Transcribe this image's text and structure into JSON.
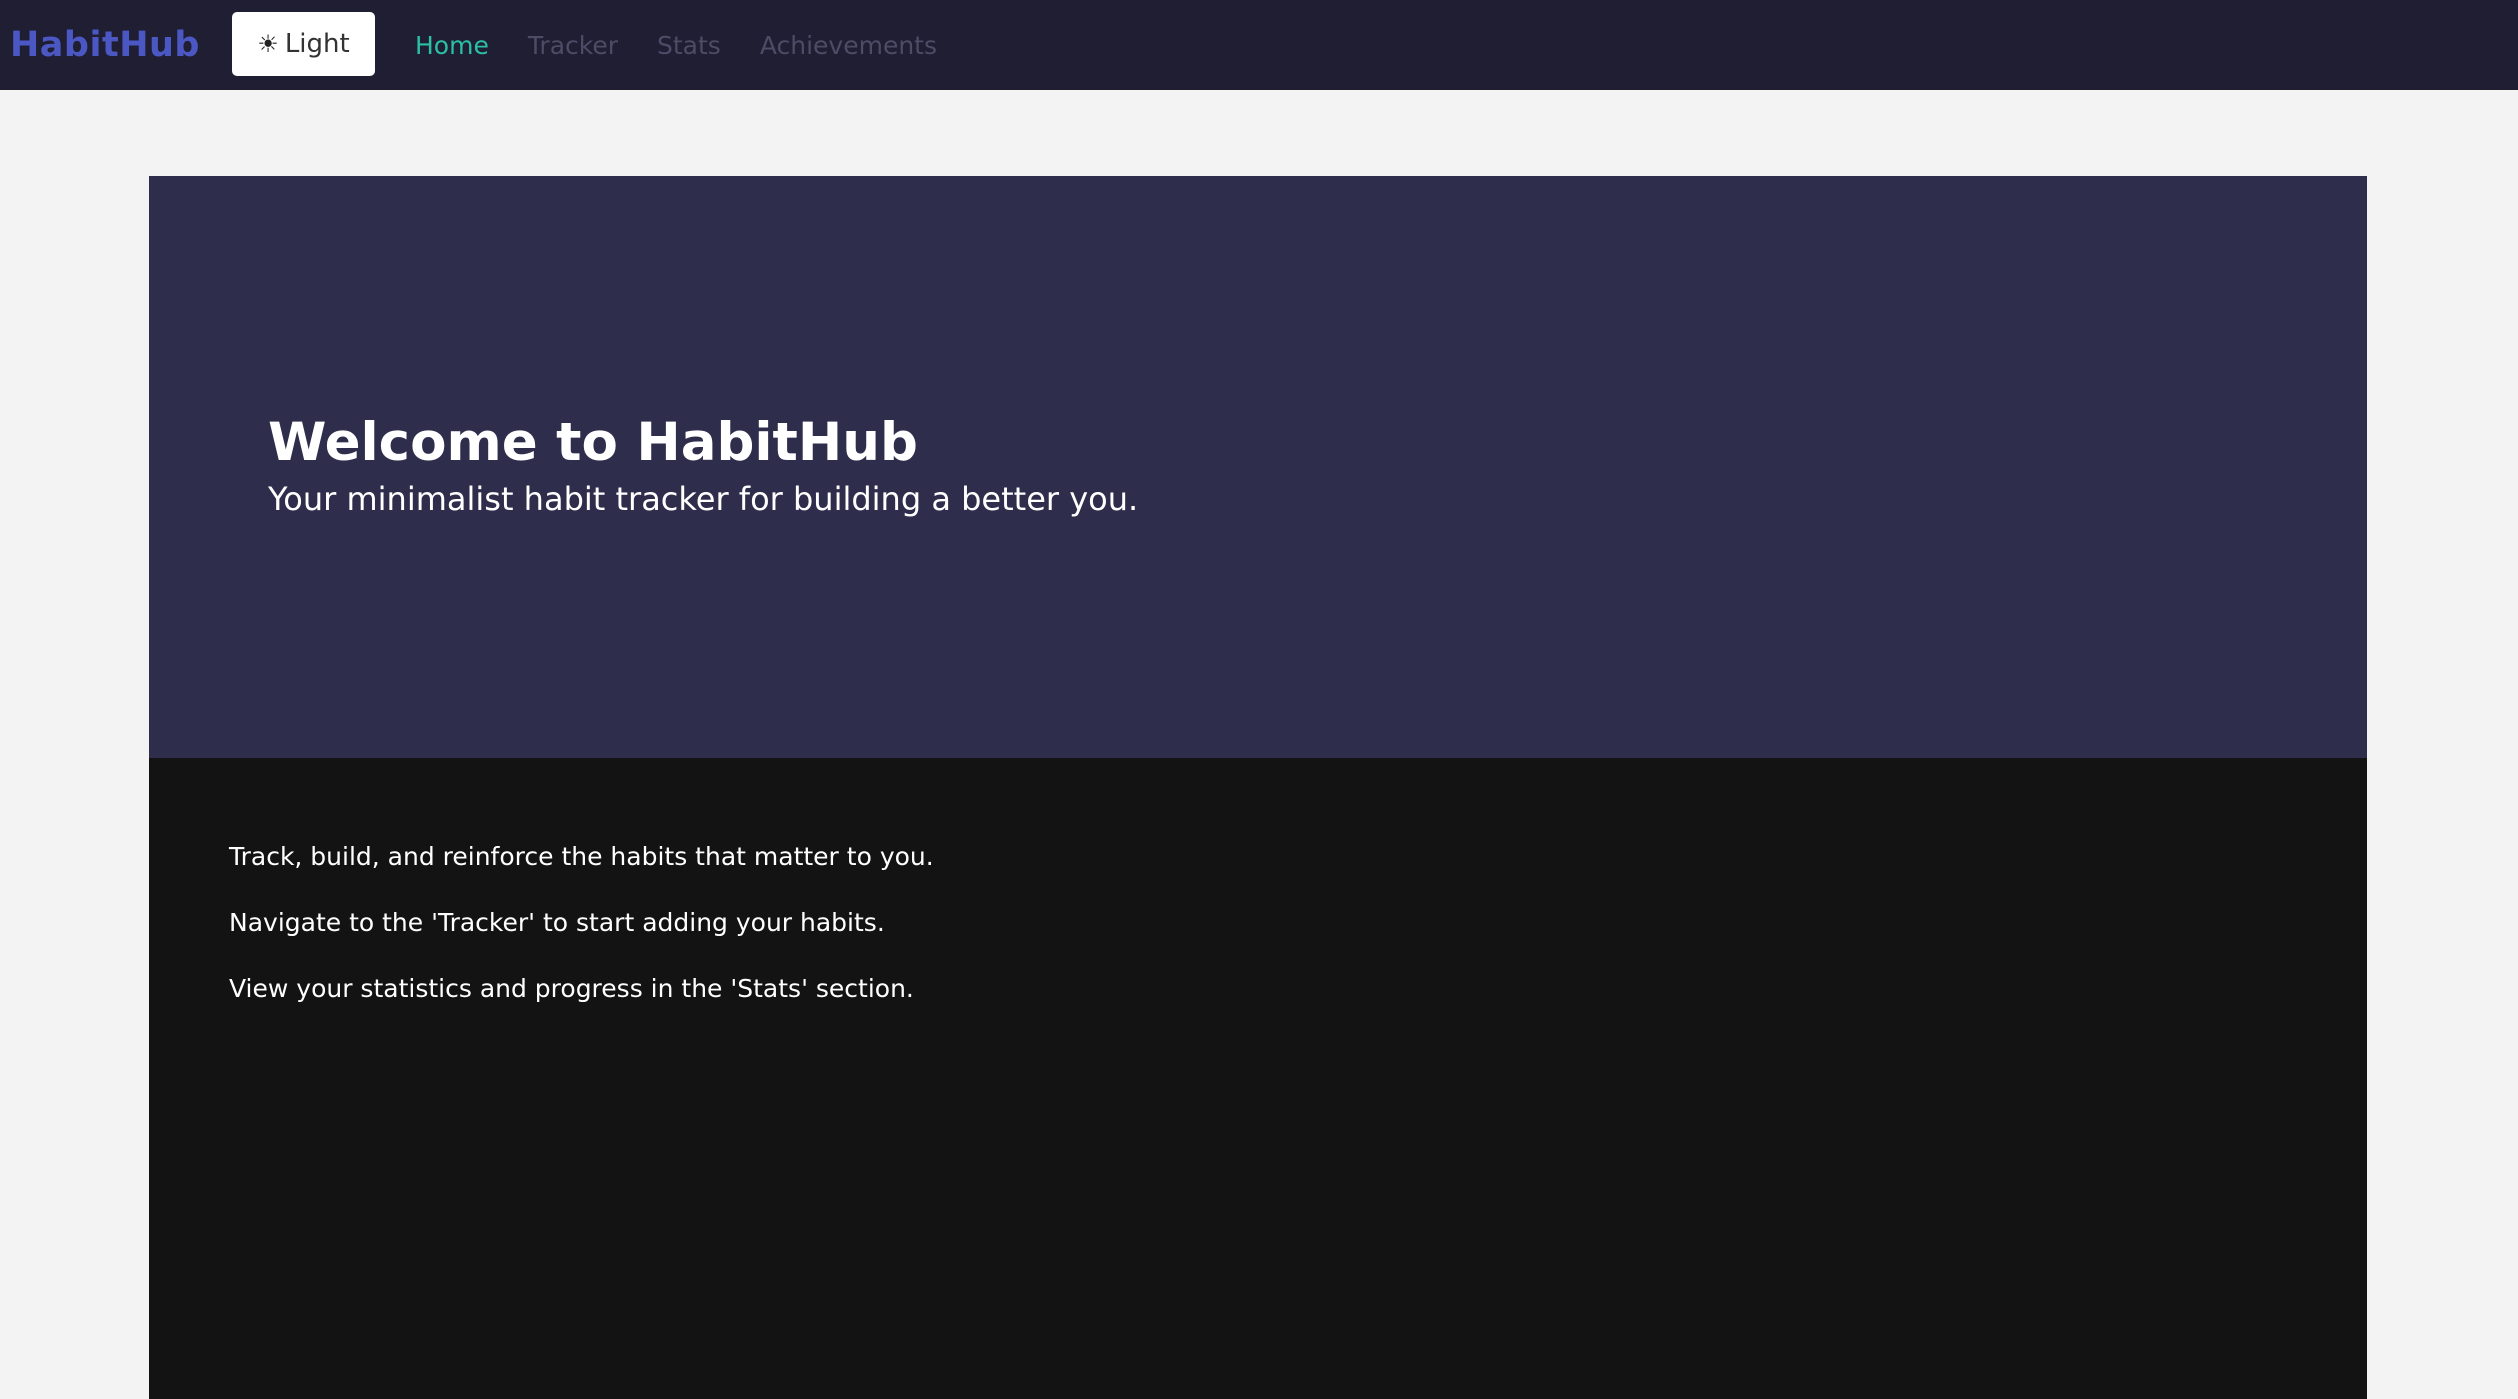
{
  "header": {
    "brand": "HabitHub",
    "theme_toggle": {
      "icon": "sun-icon",
      "glyph": "☀",
      "label": "Light"
    },
    "nav": [
      {
        "label": "Home",
        "active": true
      },
      {
        "label": "Tracker",
        "active": false
      },
      {
        "label": "Stats",
        "active": false
      },
      {
        "label": "Achievements",
        "active": false
      }
    ]
  },
  "hero": {
    "title": "Welcome to HabitHub",
    "subtitle": "Your minimalist habit tracker for building a better you."
  },
  "content": {
    "paragraphs": [
      "Track, build, and reinforce the habits that matter to you.",
      "Navigate to the 'Tracker' to start adding your habits.",
      "View your statistics and progress in the 'Stats' section."
    ]
  },
  "colors": {
    "navbar_bg": "#1f1e33",
    "brand": "#4b58c4",
    "nav_active": "#2bbfa5",
    "nav_inactive": "#4d4b66",
    "hero_bg": "#2e2d4c",
    "content_bg": "#131313",
    "page_bg": "#f3f3f3"
  }
}
